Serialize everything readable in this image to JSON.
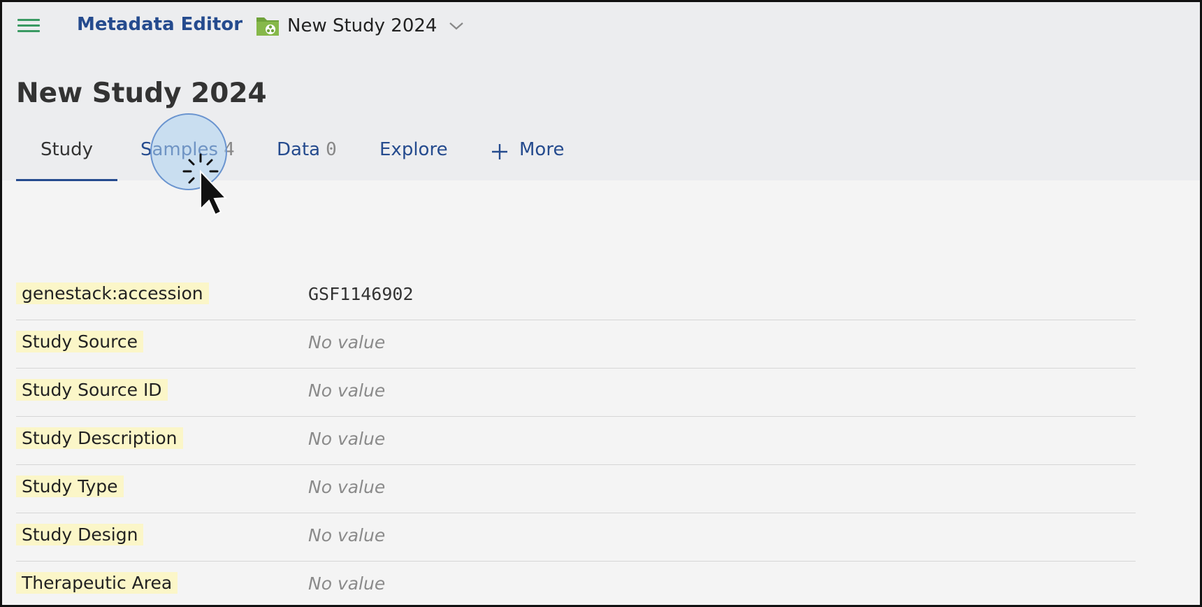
{
  "topbar": {
    "app_title": "Metadata Editor",
    "study_switcher_label": "New Study 2024"
  },
  "page": {
    "title": "New Study 2024"
  },
  "tabs": [
    {
      "label": "Study",
      "count": "",
      "active": true
    },
    {
      "label": "Samples",
      "count": "4",
      "active": false
    },
    {
      "label": "Data",
      "count": "0",
      "active": false
    },
    {
      "label": "Explore",
      "count": "",
      "active": false
    },
    {
      "label": "More",
      "count": "",
      "active": false
    }
  ],
  "properties": [
    {
      "key": "genestack:accession",
      "value": "GSF1146902"
    },
    {
      "key": "Study Source",
      "value": "No value"
    },
    {
      "key": "Study Source ID",
      "value": "No value"
    },
    {
      "key": "Study Description",
      "value": "No value"
    },
    {
      "key": "Study Type",
      "value": "No value"
    },
    {
      "key": "Study Design",
      "value": "No value"
    },
    {
      "key": "Therapeutic Area",
      "value": "No value"
    }
  ],
  "icons": {
    "menu": "hamburger-menu-icon",
    "folder": "study-folder-icon",
    "switcher": "chevron-down-icon",
    "more": "plus-icon",
    "pointer": "click-cursor-icon"
  },
  "colors": {
    "brand": "#254b8e",
    "menu_icon": "#3a9a63",
    "folder_icon": "#6fa23a",
    "key_highlight": "#fbf6c8",
    "header_band": "#ecedef",
    "content_bg": "#f4f4f4",
    "click_ring": "#6a94cf"
  }
}
